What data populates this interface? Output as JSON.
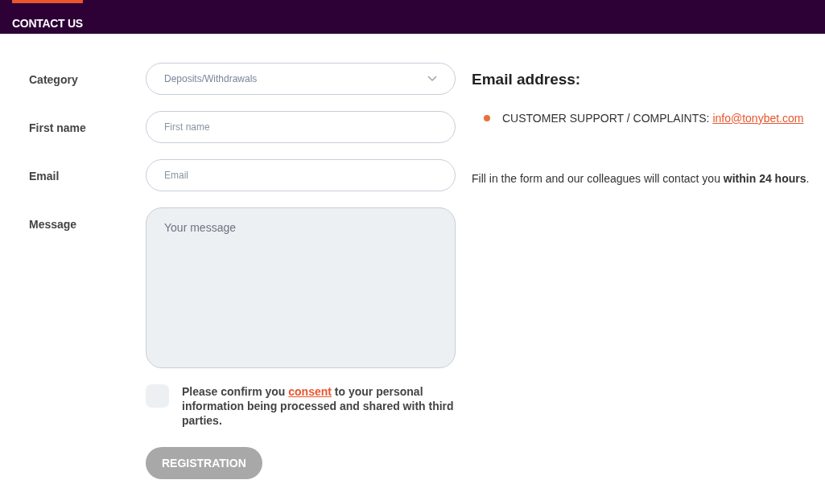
{
  "tabs": [
    {
      "label": "CONTACT US",
      "selected": true
    }
  ],
  "form": {
    "fields": [
      {
        "kind": "select",
        "label": "Category",
        "value": "Deposits/Withdrawals"
      },
      {
        "kind": "input",
        "label": "First name",
        "placeholder": "First name"
      },
      {
        "kind": "input",
        "label": "Email",
        "placeholder": "Email"
      },
      {
        "kind": "textarea",
        "label": "Message",
        "placeholder": "Your message"
      }
    ],
    "consent": {
      "checked": false,
      "text_before": "Please confirm you",
      "link": "consent",
      "text_after": "to your personal information being processed and shared with third parties."
    },
    "submit": {
      "label": "REGISTRATION",
      "disabled": true
    }
  },
  "info": {
    "heading": "Email address:",
    "contacts": [
      {
        "label": "CUSTOMER SUPPORT / COMPLAINTS:",
        "email": "info@tonybet.com"
      }
    ],
    "note": "Fill in the form and our colleagues will contact you **within 24 hours**."
  }
}
